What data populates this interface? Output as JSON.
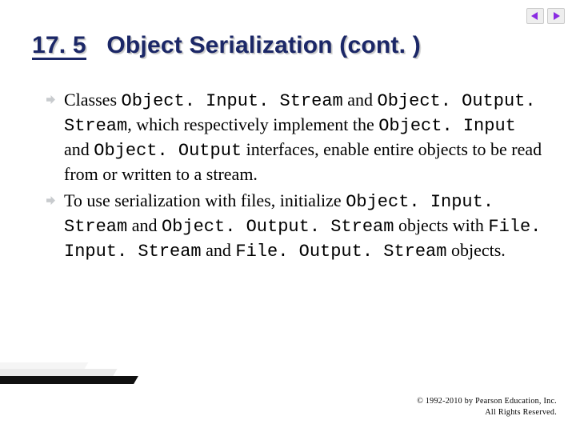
{
  "nav": {
    "prev_icon": "nav-prev-icon",
    "next_icon": "nav-next-icon"
  },
  "title": {
    "section_number": "17. 5",
    "text": "Object Serialization (cont. )"
  },
  "bullets": [
    {
      "parts": [
        {
          "t": "Classes ",
          "code": false
        },
        {
          "t": "Object. Input. Stream",
          "code": true
        },
        {
          "t": " and ",
          "code": false
        },
        {
          "t": "Object. Output. Stream",
          "code": true
        },
        {
          "t": ", which respectively implement the ",
          "code": false
        },
        {
          "t": "Object. Input",
          "code": true
        },
        {
          "t": " and ",
          "code": false
        },
        {
          "t": "Object. Output",
          "code": true
        },
        {
          "t": " interfaces, enable entire objects to be read from or written to a stream.",
          "code": false
        }
      ]
    },
    {
      "parts": [
        {
          "t": "To use serialization with files, initialize ",
          "code": false
        },
        {
          "t": "Object. Input. Stream",
          "code": true
        },
        {
          "t": " and ",
          "code": false
        },
        {
          "t": "Object. Output. Stream",
          "code": true
        },
        {
          "t": " objects with ",
          "code": false
        },
        {
          "t": "File. Input. Stream",
          "code": true
        },
        {
          "t": " and ",
          "code": false
        },
        {
          "t": "File. Output. Stream",
          "code": true
        },
        {
          "t": " objects.",
          "code": false
        }
      ]
    }
  ],
  "footer": {
    "line1": "© 1992-2010 by Pearson Education, Inc.",
    "line2": "All Rights Reserved."
  },
  "colors": {
    "title": "#1b2767",
    "nav_arrow": "#8a2be2",
    "bullet_marker": "#9aa0a6"
  }
}
